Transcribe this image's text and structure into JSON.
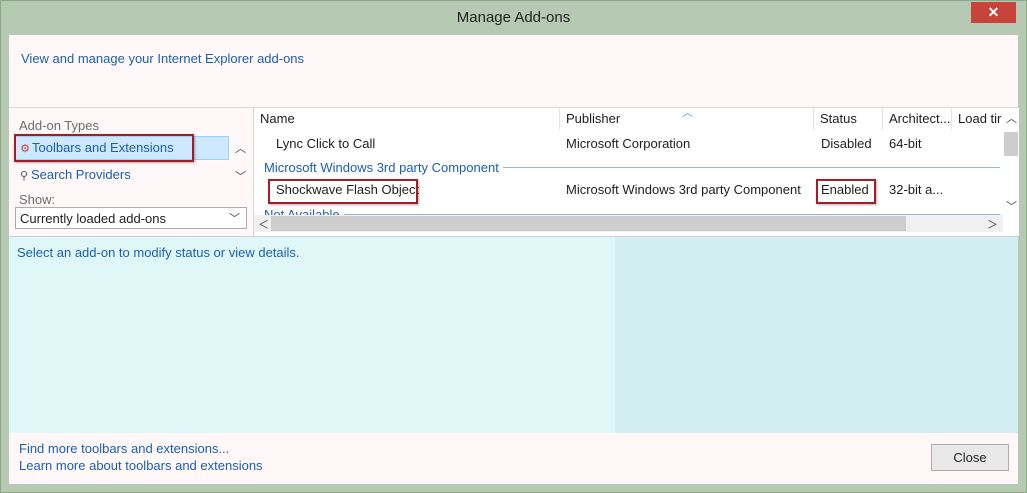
{
  "window": {
    "title": "Manage Add-ons",
    "close_glyph": "✕"
  },
  "header": {
    "link_text": "View and manage your Internet Explorer add-ons"
  },
  "left": {
    "types_label": "Add-on Types",
    "types": [
      {
        "label": "Toolbars and Extensions",
        "icon": "gear-blocked-icon",
        "selected": true
      },
      {
        "label": "Search Providers",
        "icon": "search-icon",
        "selected": false
      }
    ],
    "show_label": "Show:",
    "show_value": "Currently loaded add-ons"
  },
  "list": {
    "columns": [
      "Name",
      "Publisher",
      "Status",
      "Architect...",
      "Load tir"
    ],
    "rows": [
      {
        "name": "Lync Click to Call",
        "publisher": "Microsoft Corporation",
        "status": "Disabled",
        "arch": "64-bit"
      }
    ],
    "group1": "Microsoft Windows 3rd party Component",
    "group1_rows": [
      {
        "name": "Shockwave Flash Object",
        "publisher": "Microsoft Windows 3rd party Component",
        "status": "Enabled",
        "arch": "32-bit a..."
      }
    ],
    "group2": "Not Available"
  },
  "details": {
    "message": "Select an add-on to modify status or view details."
  },
  "footer": {
    "link1": "Find more toolbars and extensions...",
    "link2": "Learn more about toolbars and extensions",
    "close_label": "Close"
  },
  "colors": {
    "accent": "#1a5fb4",
    "highlight_box": "#a51d24",
    "selection": "#cde8ff",
    "title_bar": "#b6c9b3"
  }
}
